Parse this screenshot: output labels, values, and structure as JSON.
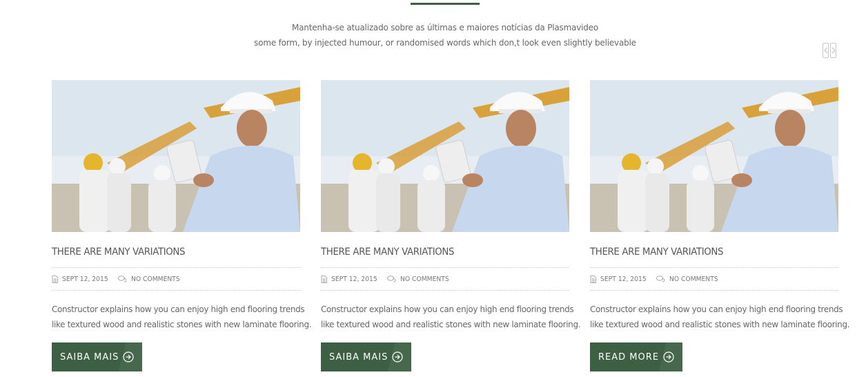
{
  "section": {
    "intro_line1": "Mantenha-se atualizado sobre as últimas e maiores notícias da Plasmavideo",
    "intro_line2": "some form, by injected humour, or randomised words which don,t look even slightly believable",
    "accent_color": "#3d5f43"
  },
  "carousel": {
    "prev_icon": "chevron-left-icon",
    "next_icon": "chevron-right-icon"
  },
  "posts": [
    {
      "title": "THERE ARE MANY VARIATIONS",
      "date": "SEPT 12, 2015",
      "comments": "NO COMMENTS",
      "excerpt_line1": "Constructor explains how you can enjoy high end flooring trends",
      "excerpt_line2": "like textured wood and realistic stones with new laminate flooring.",
      "button_label": "SAIBA MAIS"
    },
    {
      "title": "THERE ARE MANY VARIATIONS",
      "date": "SEPT 12, 2015",
      "comments": "NO COMMENTS",
      "excerpt_line1": "Constructor explains how you can enjoy high end flooring trends",
      "excerpt_line2": "like textured wood and realistic stones with new laminate flooring.",
      "button_label": "SAIBA MAIS"
    },
    {
      "title": "THERE ARE MANY VARIATIONS",
      "date": "SEPT 12, 2015",
      "comments": "NO COMMENTS",
      "excerpt_line1": "Constructor explains how you can enjoy high end flooring trends",
      "excerpt_line2": "like textured wood and realistic stones with new laminate flooring.",
      "button_label": "READ MORE"
    }
  ]
}
